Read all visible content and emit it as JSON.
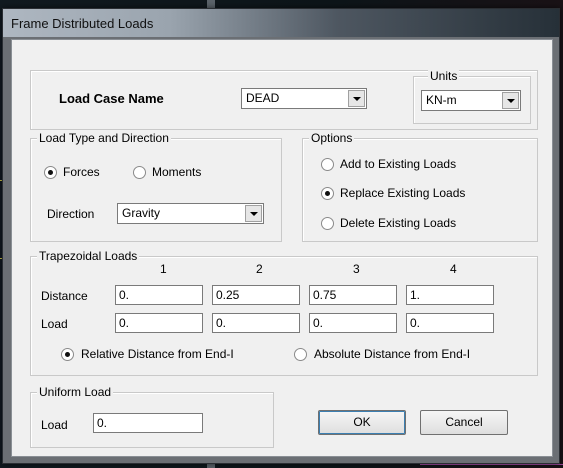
{
  "window": {
    "title": "Frame Distributed Loads"
  },
  "load_case": {
    "label": "Load Case Name",
    "value": "DEAD"
  },
  "units": {
    "group_title": "Units",
    "value": "KN-m"
  },
  "load_type": {
    "group_title": "Load Type and Direction",
    "forces_label": "Forces",
    "moments_label": "Moments",
    "selected": "Forces",
    "direction_label": "Direction",
    "direction_value": "Gravity"
  },
  "options": {
    "group_title": "Options",
    "items": [
      {
        "label": "Add to Existing Loads",
        "selected": false
      },
      {
        "label": "Replace Existing Loads",
        "selected": true
      },
      {
        "label": "Delete Existing Loads",
        "selected": false
      }
    ]
  },
  "trapezoidal": {
    "group_title": "Trapezoidal Loads",
    "columns": [
      "1",
      "2",
      "3",
      "4"
    ],
    "distance_label": "Distance",
    "distances": [
      "0.",
      "0.25",
      "0.75",
      "1."
    ],
    "load_label": "Load",
    "loads": [
      "0.",
      "0.",
      "0.",
      "0."
    ],
    "relative_label": "Relative Distance from End-I",
    "absolute_label": "Absolute Distance from End-I",
    "selected": "relative"
  },
  "uniform": {
    "group_title": "Uniform Load",
    "load_label": "Load",
    "load_value": "0."
  },
  "buttons": {
    "ok": "OK",
    "cancel": "Cancel"
  },
  "colors": {
    "dialog_bg": "#f0f0f0",
    "titlebar_light": "#aeb7c1",
    "titlebar_dark": "#263038"
  }
}
